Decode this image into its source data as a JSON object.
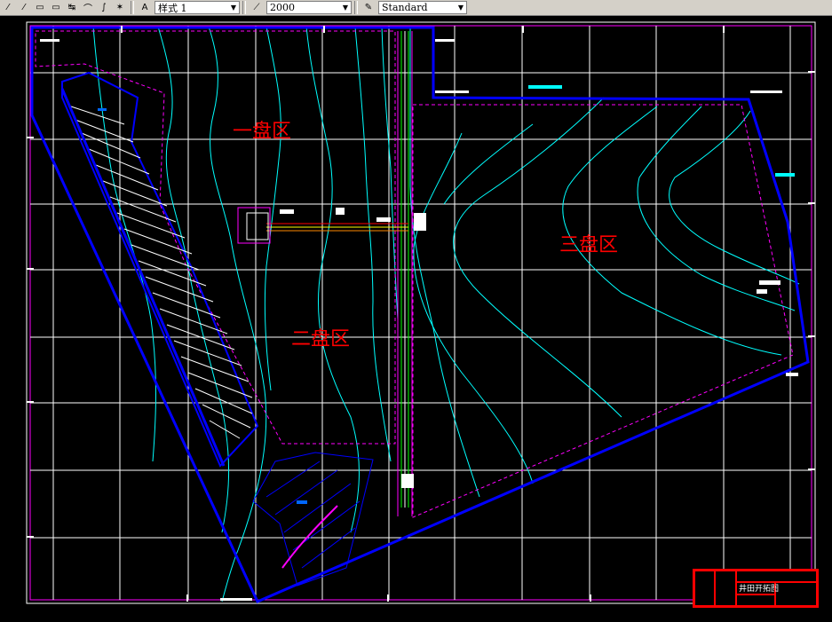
{
  "toolbar": {
    "style_combo": "样式 1",
    "scale_combo": "2000",
    "text_style_combo": "Standard",
    "icons": [
      "line-icon",
      "polyline-icon",
      "rectangle-icon",
      "rectangle2-icon",
      "move-icon",
      "arc-icon",
      "curve-icon",
      "explode-icon",
      "dimension-icon",
      "pen-icon",
      "text-style-icon"
    ]
  },
  "drawing": {
    "labels": {
      "zone1": "一盘区",
      "zone2": "二盘区",
      "zone3": "三盘区"
    },
    "colors": {
      "boundary": "#0000ff",
      "contour": "#00ffff",
      "grid": "#ffffff",
      "dashed": "#ff00ff",
      "label": "#ff0000"
    }
  },
  "title_block": {
    "drawing_name": "井田开拓图"
  }
}
